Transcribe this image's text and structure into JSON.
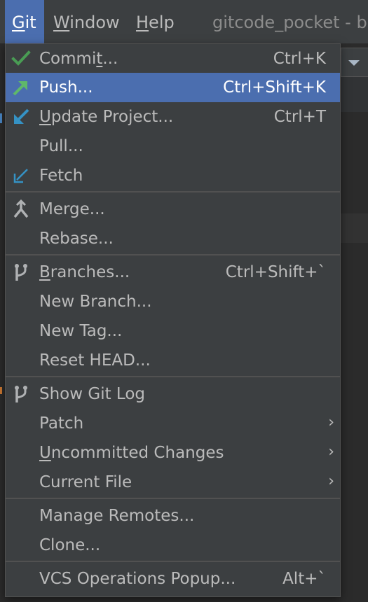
{
  "menubar": {
    "git": "Git",
    "git_rest": "it",
    "git_mnemonic": "G",
    "window_mnemonic": "W",
    "window_rest": "indow",
    "help_mnemonic": "H",
    "help_rest": "elp",
    "title": "gitcode_pocket - bu"
  },
  "menu": {
    "commit": {
      "pre": "Commi",
      "mn": "t",
      "post": "...",
      "shortcut": "Ctrl+K",
      "icon": "check-icon"
    },
    "push": {
      "label": "Push...",
      "shortcut": "Ctrl+Shift+K",
      "icon": "push-arrow-icon"
    },
    "update": {
      "mn": "U",
      "post": "pdate Project...",
      "shortcut": "Ctrl+T",
      "icon": "update-arrow-icon"
    },
    "pull": {
      "label": "Pull..."
    },
    "fetch": {
      "label": "Fetch",
      "icon": "fetch-icon"
    },
    "merge": {
      "label": "Merge...",
      "icon": "merge-icon"
    },
    "rebase": {
      "label": "Rebase..."
    },
    "branches": {
      "mn": "B",
      "post": "ranches...",
      "shortcut": "Ctrl+Shift+`",
      "icon": "branch-icon"
    },
    "new_branch": {
      "label": "New Branch..."
    },
    "new_tag": {
      "label": "New Tag..."
    },
    "reset_head": {
      "label": "Reset HEAD..."
    },
    "show_git_log": {
      "label": "Show Git Log",
      "icon": "git-log-icon"
    },
    "patch": {
      "label": "Patch"
    },
    "uncommitted": {
      "mn": "U",
      "post": "ncommitted Changes"
    },
    "current_file": {
      "label": "Current File"
    },
    "manage_remotes": {
      "label": "Manage Remotes..."
    },
    "clone": {
      "label": "Clone..."
    },
    "vcs_popup": {
      "label": "VCS Operations Popup...",
      "shortcut": "Alt+`"
    }
  },
  "colors": {
    "selection": "#4b6eaf",
    "menu_bg": "#3c3f41",
    "text": "#bbbbbb",
    "green": "#499c54",
    "blue": "#3592c4"
  }
}
